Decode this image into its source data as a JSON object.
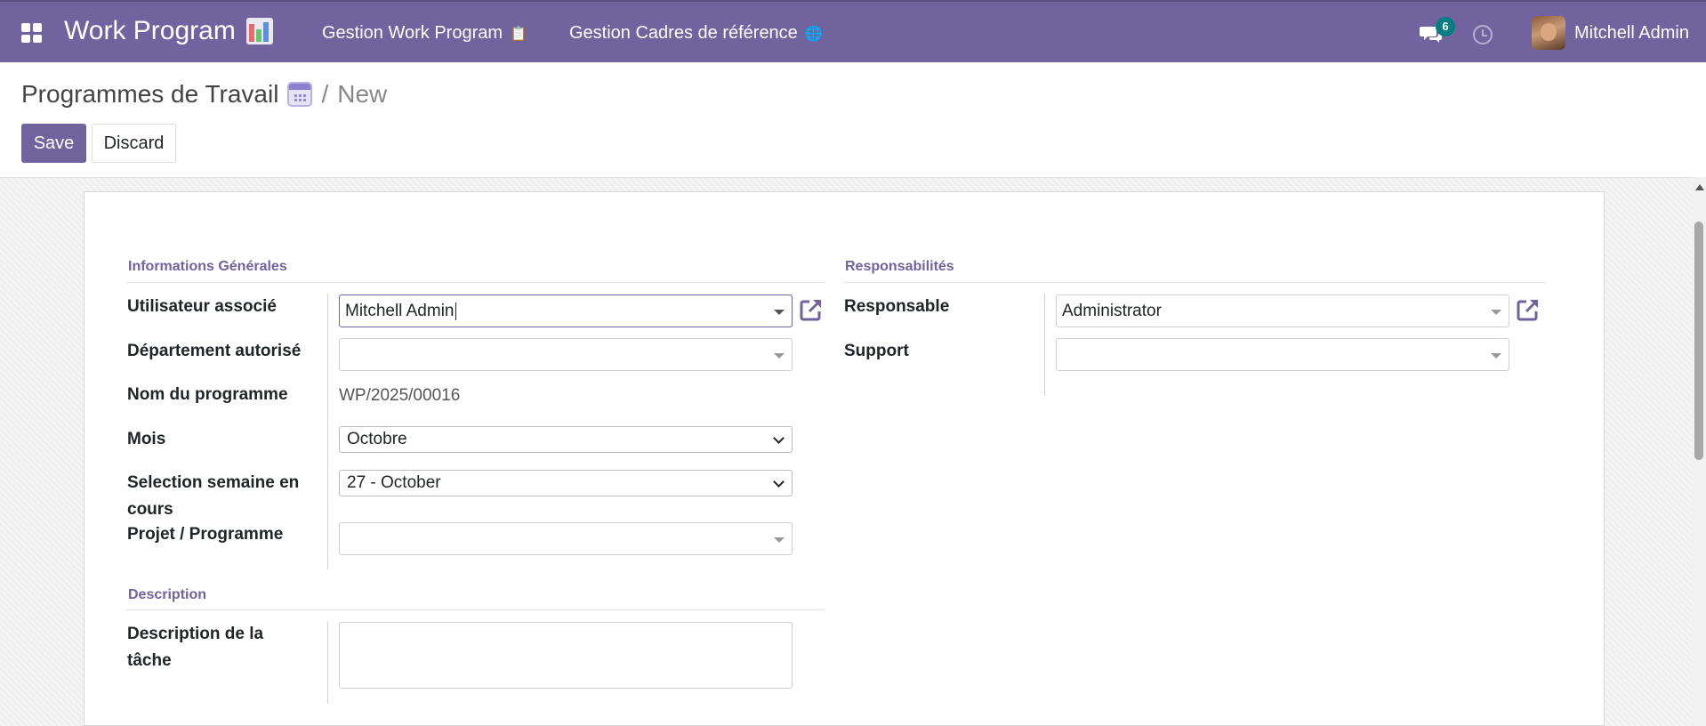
{
  "navbar": {
    "app_title": "Work Program",
    "menu_items": [
      {
        "label": "Gestion Work Program",
        "emoji": "📋"
      },
      {
        "label": "Gestion Cadres de référence",
        "emoji": "🌐"
      }
    ],
    "messages_count": "6",
    "user_name": "Mitchell Admin",
    "color": "#71639e"
  },
  "control_panel": {
    "breadcrumb_title": "Programmes de Travail",
    "breadcrumb_separator": "/",
    "breadcrumb_current": "New",
    "save_label": "Save",
    "discard_label": "Discard"
  },
  "form": {
    "section_general": "Informations Générales",
    "section_resp": "Responsabilités",
    "section_description": "Description",
    "fields": {
      "user": {
        "label": "Utilisateur associé",
        "value": "Mitchell Admin"
      },
      "department": {
        "label": "Département autorisé",
        "value": ""
      },
      "program_name": {
        "label": "Nom du programme",
        "value": "WP/2025/00016"
      },
      "month": {
        "label": "Mois",
        "value": "Octobre"
      },
      "week": {
        "label_line1": "Selection semaine en",
        "label_line2": "cours",
        "value": "27 - October"
      },
      "project": {
        "label": "Projet / Programme",
        "value": ""
      },
      "responsible": {
        "label": "Responsable",
        "value": "Administrator"
      },
      "support": {
        "label": "Support",
        "value": ""
      },
      "task_description": {
        "label_line1": "Description de la",
        "label_line2": "tâche",
        "value": ""
      }
    }
  }
}
